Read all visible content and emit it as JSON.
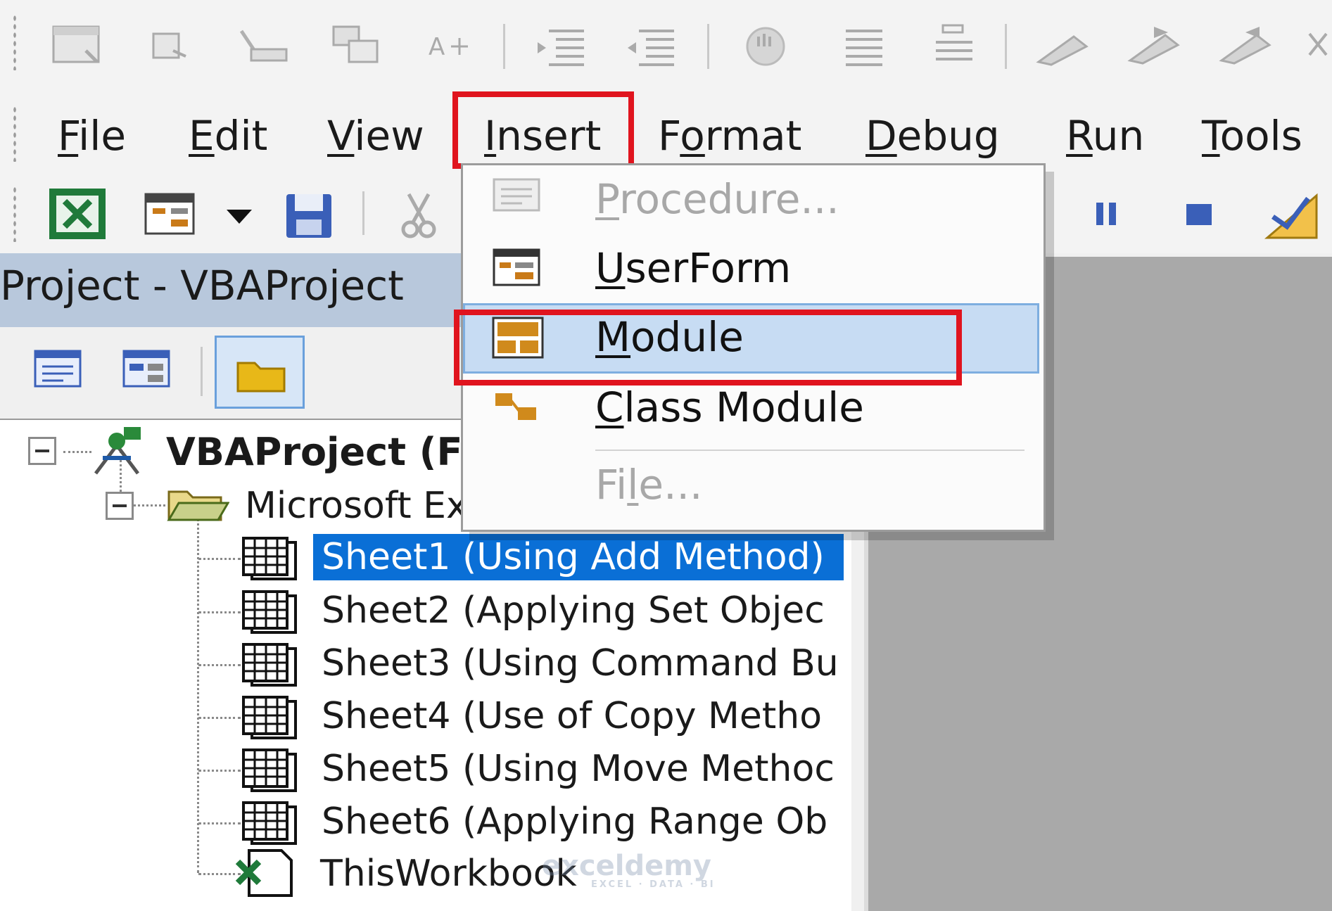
{
  "menubar": {
    "items": [
      {
        "accel": "F",
        "rest": "ile"
      },
      {
        "accel": "E",
        "rest": "dit"
      },
      {
        "accel": "V",
        "rest": "iew"
      },
      {
        "accel": "I",
        "rest": "nsert"
      },
      {
        "pre": "F",
        "accel": "o",
        "rest": "rmat"
      },
      {
        "accel": "D",
        "rest": "ebug"
      },
      {
        "accel": "R",
        "rest": "un"
      },
      {
        "accel": "T",
        "rest": "ools"
      }
    ]
  },
  "insert_menu": {
    "procedure": {
      "accel": "P",
      "rest": "rocedure..."
    },
    "userform": {
      "accel": "U",
      "rest": "serForm"
    },
    "module": {
      "accel": "M",
      "rest": "odule"
    },
    "class_module": {
      "accel": "C",
      "rest": "lass Module"
    },
    "file": {
      "pre": "Fi",
      "accel": "l",
      "rest": "e..."
    }
  },
  "project_pane": {
    "title": "Project - VBAProject"
  },
  "tree": {
    "root": "VBAProject (F",
    "folder": "Microsoft Ex",
    "sheets": [
      "Sheet1 (Using Add Method)",
      "Sheet2 (Applying Set Objec",
      "Sheet3 (Using Command Bu",
      "Sheet4 (Use of Copy Metho",
      "Sheet5 (Using Move Methoc",
      "Sheet6 (Applying Range Ob"
    ],
    "workbook": "ThisWorkbook"
  },
  "watermark": {
    "name": "exceldemy",
    "tagline": "EXCEL · DATA · BI"
  },
  "colors": {
    "highlight_box": "#e0141e",
    "selection": "#0a6fd6",
    "menu_hover": "#c7dcf3"
  }
}
